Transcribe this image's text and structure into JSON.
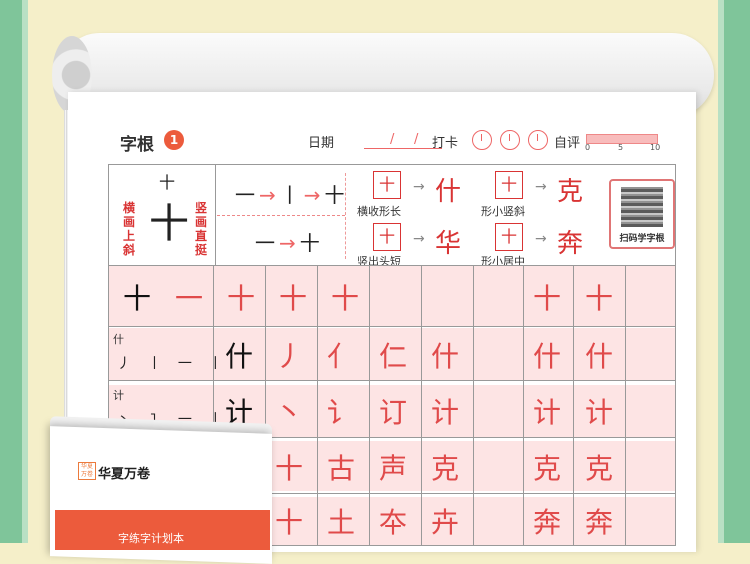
{
  "header": {
    "title": "字根",
    "number": "1",
    "date_label": "日期",
    "checkin_label": "打卡",
    "selfeval_label": "自评",
    "scale": [
      "0",
      "5",
      "10"
    ]
  },
  "intro": {
    "top_char": "十",
    "root_char": "十",
    "left_note": "横画上斜",
    "right_note": "竖画直挺",
    "stroke_seq": [
      "一",
      "丨",
      "十"
    ],
    "stroke_seq2": [
      "一",
      "十"
    ]
  },
  "components": [
    {
      "box": "十",
      "caption": "横收形长",
      "result": "什"
    },
    {
      "box": "十",
      "caption": "竖出头短",
      "result": "华"
    },
    {
      "box": "十",
      "caption": "形小竖斜",
      "result": "克"
    },
    {
      "box": "十",
      "caption": "形小居中",
      "result": "奔"
    }
  ],
  "qr": {
    "caption": "扫码学字根"
  },
  "practice_row1": {
    "main": "十",
    "trace": [
      "一",
      "十",
      "十",
      "十",
      "十",
      "十"
    ]
  },
  "practice_rows": [
    {
      "label": "什",
      "strokes": "丿 丨 一 丨",
      "main": "什",
      "trace": [
        "丿",
        "亻",
        "仁",
        "什",
        "什",
        "什"
      ]
    },
    {
      "label": "计",
      "strokes": "丶 ㇊ 一 丨",
      "main": "计",
      "trace": [
        "丶",
        "讠",
        "订",
        "计",
        "计",
        "计"
      ]
    },
    {
      "label": "",
      "strokes": "",
      "main": "",
      "trace": [
        "十",
        "古",
        "声",
        "克",
        "克",
        "克"
      ]
    },
    {
      "label": "",
      "strokes": "",
      "main": "",
      "trace": [
        "十",
        "土",
        "夲",
        "卉",
        "奔",
        "奔"
      ]
    }
  ],
  "book": {
    "brand": "华夏万卷",
    "logo": "华夏万卷",
    "subtitle": "字练字计划本"
  },
  "colors": {
    "accent": "#ec5b3c",
    "frame": "#7fc59a",
    "red_ink": "#d93434"
  }
}
